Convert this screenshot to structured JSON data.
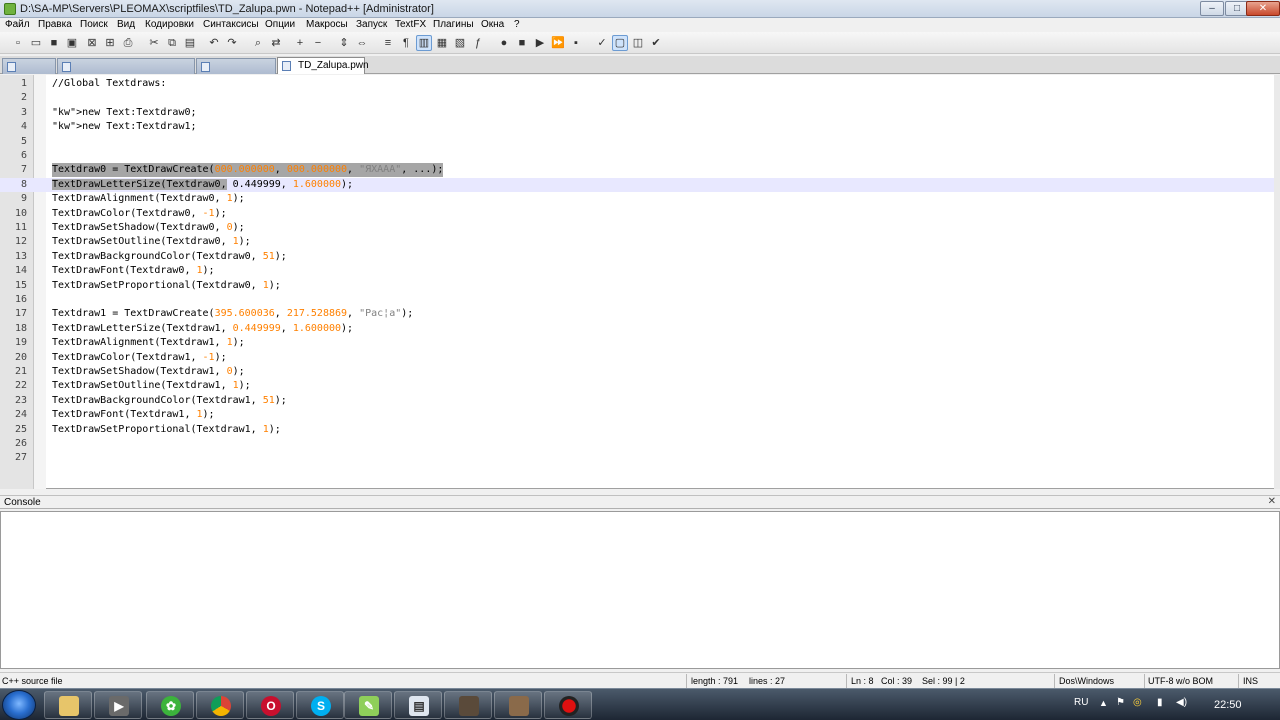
{
  "window": {
    "title": "D:\\SA-MP\\Servers\\PLEOMAX\\scriptfiles\\TD_Zalupa.pwn - Notepad++ [Administrator]",
    "minimize": "–",
    "maximize": "□",
    "close": "✕"
  },
  "menu": [
    "Файл",
    "Правка",
    "Поиск",
    "Вид",
    "Кодировки",
    "Синтаксисы",
    "Опции",
    "Макросы",
    "Запуск",
    "TextFX",
    "Плагины",
    "Окна",
    "?"
  ],
  "toolbar_icons": [
    "new-file-icon",
    "open-file-icon",
    "save-icon",
    "save-all-icon",
    "close-file-icon",
    "close-all-icon",
    "print-icon",
    "cut-icon",
    "copy-icon",
    "paste-icon",
    "undo-icon",
    "redo-icon",
    "find-icon",
    "replace-icon",
    "zoom-in-icon",
    "zoom-out-icon",
    "sync-vertical-icon",
    "sync-horizontal-icon",
    "word-wrap-icon",
    "show-all-chars-icon",
    "indent-guide-icon",
    "user-lang-icon",
    "doc-map-icon",
    "function-list-icon",
    "record-macro-icon",
    "stop-macro-icon",
    "play-macro-icon",
    "run-macro-multiple-icon",
    "save-macro-icon",
    "spell-check-icon",
    "view-panel-icon",
    "preview-icon",
    "check-icon"
  ],
  "tabs": [
    {
      "label": "",
      "active": false
    },
    {
      "label": "",
      "active": false
    },
    {
      "label": "",
      "active": false
    },
    {
      "label": "TD_Zalupa.pwn",
      "active": true
    }
  ],
  "editor": {
    "current_line": 8,
    "lines": [
      {
        "n": "1",
        "t": "//Global Textdraws:"
      },
      {
        "n": "2",
        "t": ""
      },
      {
        "n": "3",
        "t": "new Text:Textdraw0;"
      },
      {
        "n": "4",
        "t": "new Text:Textdraw1;"
      },
      {
        "n": "5",
        "t": ""
      },
      {
        "n": "6",
        "t": ""
      },
      {
        "n": "7",
        "t": "Textdraw0 = TextDrawCreate(000.000000, 000.000000, \"ЯХААА\", ...);"
      },
      {
        "n": "8",
        "t": "TextDrawLetterSize(Textdraw0, 0.449999, 1.600000);"
      },
      {
        "n": "9",
        "t": "TextDrawAlignment(Textdraw0, 1);"
      },
      {
        "n": "10",
        "t": "TextDrawColor(Textdraw0, -1);"
      },
      {
        "n": "11",
        "t": "TextDrawSetShadow(Textdraw0, 0);"
      },
      {
        "n": "12",
        "t": "TextDrawSetOutline(Textdraw0, 1);"
      },
      {
        "n": "13",
        "t": "TextDrawBackgroundColor(Textdraw0, 51);"
      },
      {
        "n": "14",
        "t": "TextDrawFont(Textdraw0, 1);"
      },
      {
        "n": "15",
        "t": "TextDrawSetProportional(Textdraw0, 1);"
      },
      {
        "n": "16",
        "t": ""
      },
      {
        "n": "17",
        "t": "Textdraw1 = TextDrawCreate(395.600036, 217.528869, \"Pac¦a\");"
      },
      {
        "n": "18",
        "t": "TextDrawLetterSize(Textdraw1, 0.449999, 1.600000);"
      },
      {
        "n": "19",
        "t": "TextDrawAlignment(Textdraw1, 1);"
      },
      {
        "n": "20",
        "t": "TextDrawColor(Textdraw1, -1);"
      },
      {
        "n": "21",
        "t": "TextDrawSetShadow(Textdraw1, 0);"
      },
      {
        "n": "22",
        "t": "TextDrawSetOutline(Textdraw1, 1);"
      },
      {
        "n": "23",
        "t": "TextDrawBackgroundColor(Textdraw1, 51);"
      },
      {
        "n": "24",
        "t": "TextDrawFont(Textdraw1, 1);"
      },
      {
        "n": "25",
        "t": "TextDrawSetProportional(Textdraw1, 1);"
      },
      {
        "n": "26",
        "t": ""
      },
      {
        "n": "27",
        "t": ""
      }
    ]
  },
  "console": {
    "title": "Console",
    "close": "✕"
  },
  "status": {
    "file_type": "C++ source file",
    "length": "length : 791",
    "lines": "lines : 27",
    "ln": "Ln : 8",
    "col": "Col : 39",
    "sel": "Sel : 99 | 2",
    "eol": "Dos\\Windows",
    "encoding": "UTF-8 w/o BOM",
    "mode": "INS"
  },
  "taskbar": {
    "apps": [
      "explorer",
      "media-player",
      "icq",
      "chrome",
      "opera",
      "skype",
      "notepad-plus-plus",
      "window",
      "game-sa",
      "game-char",
      "record"
    ],
    "language": "RU",
    "time": "22:50"
  },
  "colors": {
    "keyword": "#0000c8",
    "number": "#ff8000",
    "selection": "#a6a6a6",
    "current_line": "#e8e8ff"
  }
}
